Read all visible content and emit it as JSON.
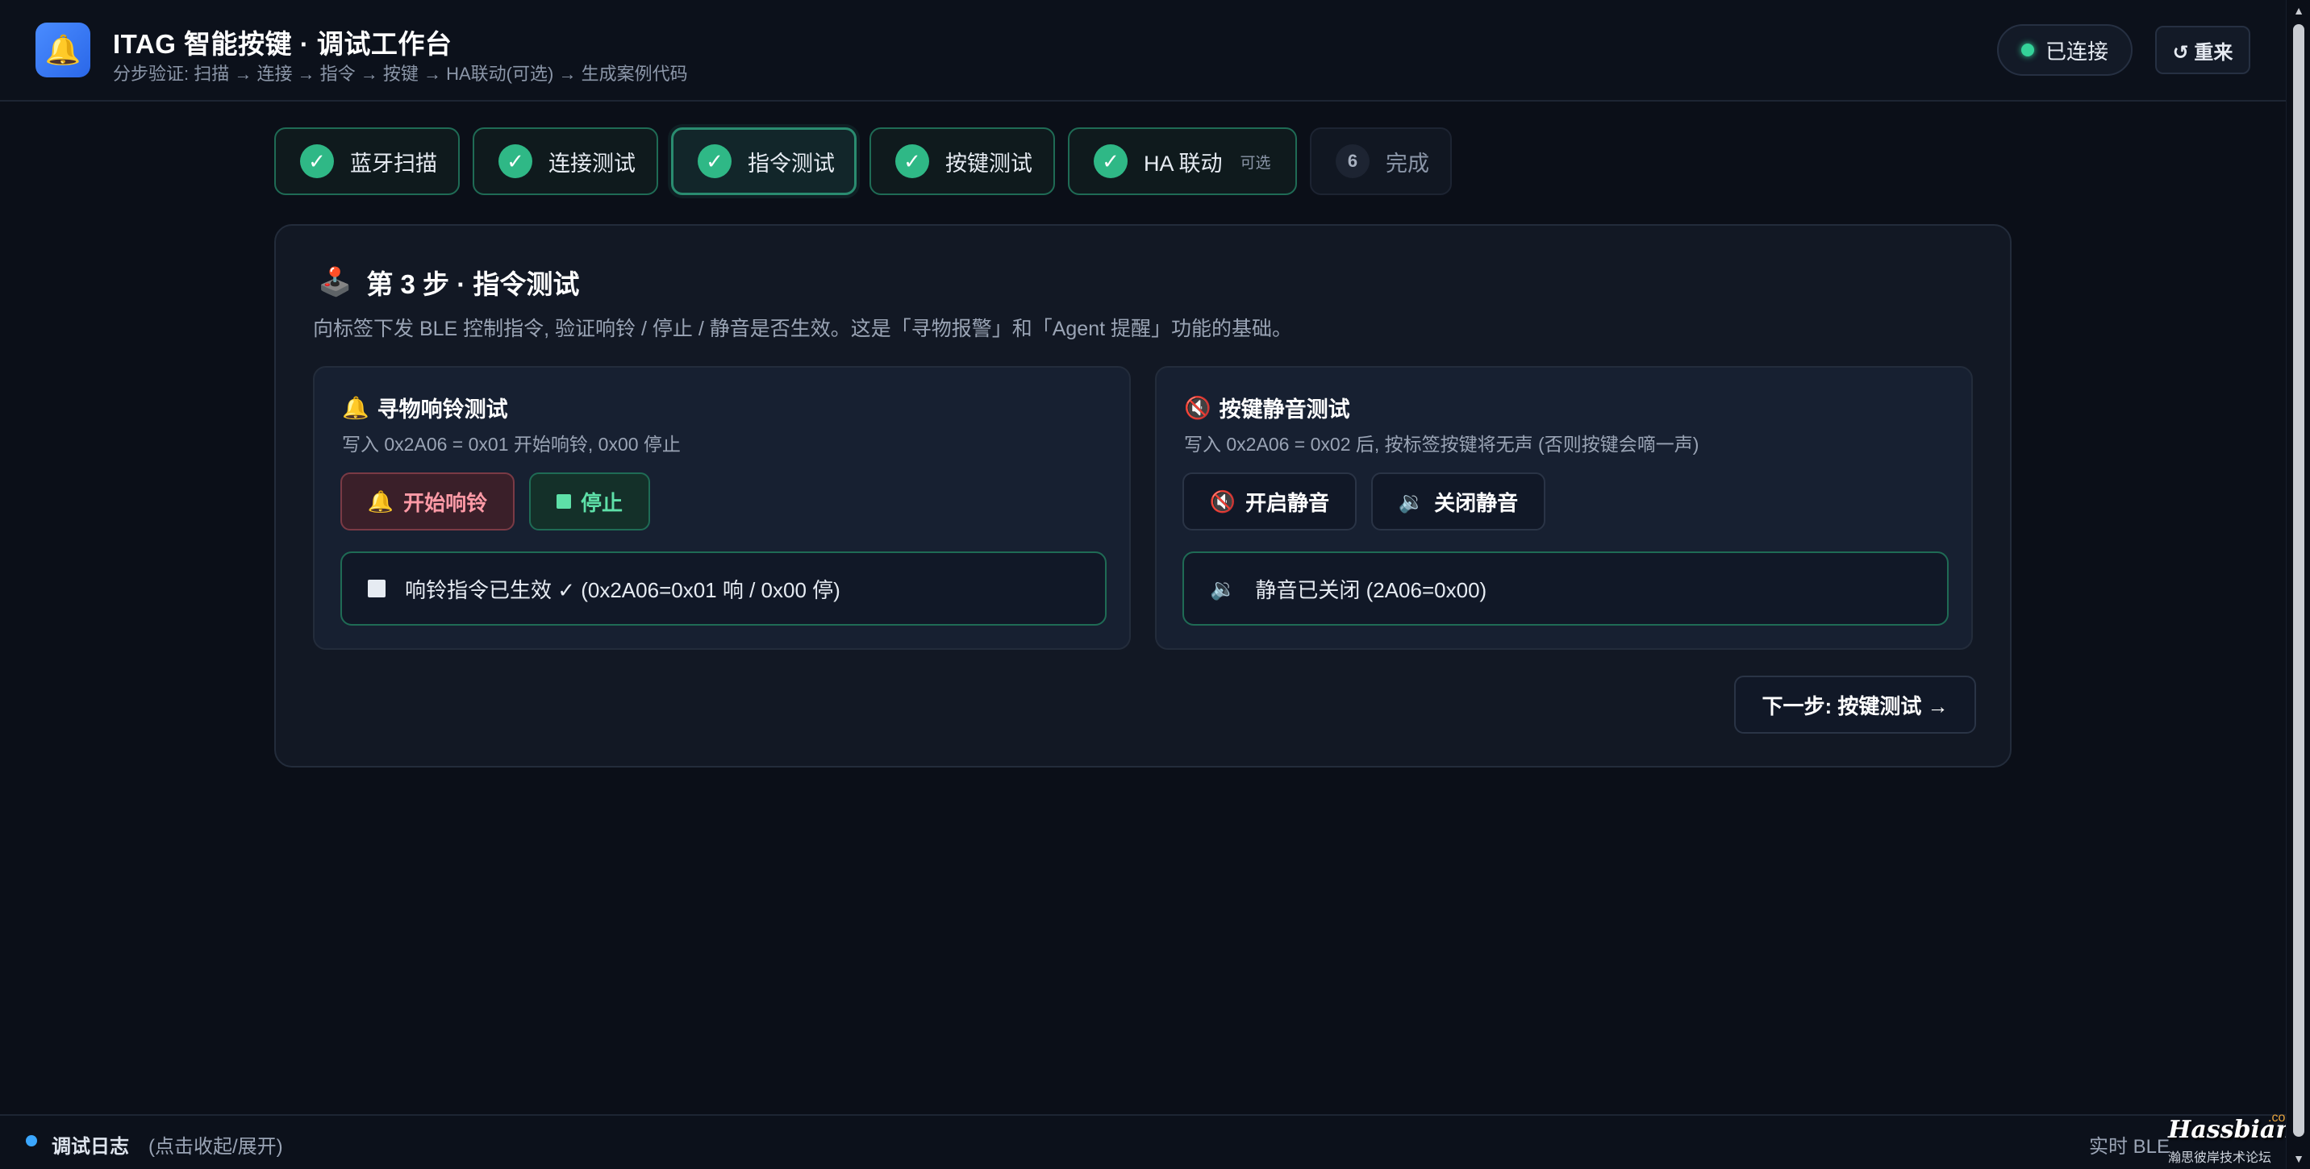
{
  "header": {
    "title": "ITAG 智能按键 · 调试工作台",
    "subtitle": "分步验证: 扫描 → 连接 → 指令 → 按键 → HA联动(可选) → 生成案例代码",
    "connection_status": "已连接",
    "reset_label": "↺ 重来"
  },
  "steps": [
    {
      "label": "蓝牙扫描",
      "state": "done"
    },
    {
      "label": "连接测试",
      "state": "done"
    },
    {
      "label": "指令测试",
      "state": "active"
    },
    {
      "label": "按键测试",
      "state": "done"
    },
    {
      "label": "HA 联动",
      "optional_tag": "可选",
      "state": "done"
    },
    {
      "label": "完成",
      "number": "6",
      "state": "pending"
    }
  ],
  "card": {
    "title": "第 3 步 · 指令测试",
    "description": "向标签下发 BLE 控制指令, 验证响铃 / 停止 / 静音是否生效。这是「寻物报警」和「Agent 提醒」功能的基础。",
    "ring_panel": {
      "title": "寻物响铃测试",
      "description": "写入 0x2A06 = 0x01 开始响铃, 0x00 停止",
      "start_label": "开始响铃",
      "stop_label": "停止",
      "status_text": "响铃指令已生效 ✓ (0x2A06=0x01 响 / 0x00 停)"
    },
    "mute_panel": {
      "title": "按键静音测试",
      "description": "写入 0x2A06 = 0x02 后, 按标签按键将无声 (否则按键会嘀一声)",
      "mute_on_label": "开启静音",
      "mute_off_label": "关闭静音",
      "status_text": "静音已关闭 (2A06=0x00)"
    },
    "next_label": "下一步: 按键测试 →"
  },
  "log": {
    "title": "调试日志",
    "hint": "(点击收起/展开)",
    "right_text": "实时 BLE"
  },
  "watermark": {
    "brand": "Hassbian",
    "com": ".com",
    "tagline": "瀚思彼岸技术论坛"
  },
  "colors": {
    "background": "#0b0f18",
    "success": "#2fb886",
    "accent_blue": "#3ba7ff",
    "danger_text": "#ff9aa6"
  }
}
